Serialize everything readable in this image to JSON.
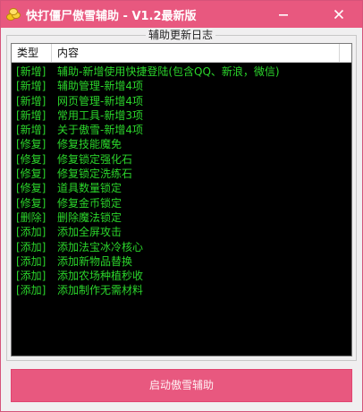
{
  "window": {
    "title": "快打僵尸傲雪辅助 - V1.2最新版",
    "accent_color": "#e8587f",
    "icons": {
      "app": "coins-icon",
      "minimize": "minimize-icon",
      "close": "close-icon"
    }
  },
  "log_panel": {
    "title": "辅助更新日志",
    "columns": [
      "类型",
      "内容"
    ],
    "text_color": "#2bd52b",
    "rows": [
      {
        "type": "[新增]",
        "content": "辅助-新增使用快捷登陆(包含QQ、新浪，微信)"
      },
      {
        "type": "[新增]",
        "content": "辅助管理-新增4项"
      },
      {
        "type": "[新增]",
        "content": "网页管理-新增4项"
      },
      {
        "type": "[新增]",
        "content": "常用工具-新增3项"
      },
      {
        "type": "[新增]",
        "content": "关于傲雪-新增4项"
      },
      {
        "type": "[修复]",
        "content": "修复技能魔免"
      },
      {
        "type": "[修复]",
        "content": "修复锁定强化石"
      },
      {
        "type": "[修复]",
        "content": "修复锁定洗练石"
      },
      {
        "type": "[修复]",
        "content": "道具数量锁定"
      },
      {
        "type": "[修复]",
        "content": "修复金币锁定"
      },
      {
        "type": "[删除]",
        "content": "删除魔法锁定"
      },
      {
        "type": "[添加]",
        "content": "添加全屏攻击"
      },
      {
        "type": "[添加]",
        "content": "添加法宝冰冷核心"
      },
      {
        "type": "[添加]",
        "content": "添加新物品替换"
      },
      {
        "type": "[添加]",
        "content": "添加农场种植秒收"
      },
      {
        "type": "[添加]",
        "content": "添加制作无需材料"
      }
    ]
  },
  "start_button": {
    "label": "启动傲雪辅助"
  }
}
